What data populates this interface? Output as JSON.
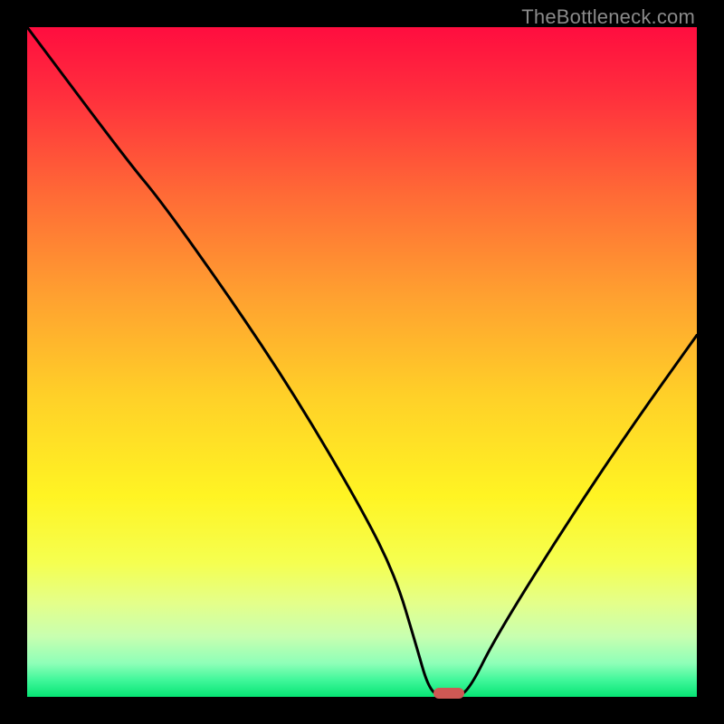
{
  "watermark": "TheBottleneck.com",
  "marker": {
    "x_pct": 63,
    "y_pct": 99.4
  },
  "chart_data": {
    "type": "line",
    "title": "",
    "xlabel": "",
    "ylabel": "",
    "xlim": [
      0,
      100
    ],
    "ylim": [
      0,
      100
    ],
    "grid": false,
    "legend": false,
    "annotations": [],
    "series": [
      {
        "name": "bottleneck-curve",
        "x": [
          0,
          15,
          20,
          30,
          40,
          50,
          55,
          58,
          60,
          62,
          64,
          66,
          70,
          80,
          90,
          100
        ],
        "values": [
          100,
          80,
          74,
          60,
          45,
          28,
          18,
          8,
          1,
          0,
          0,
          1,
          9,
          25,
          40,
          54
        ]
      }
    ],
    "background_gradient_stops": [
      {
        "offset": 0.0,
        "color": "#ff0d3f"
      },
      {
        "offset": 0.1,
        "color": "#ff2e3d"
      },
      {
        "offset": 0.25,
        "color": "#ff6a36"
      },
      {
        "offset": 0.4,
        "color": "#ffa030"
      },
      {
        "offset": 0.55,
        "color": "#ffd028"
      },
      {
        "offset": 0.7,
        "color": "#fff423"
      },
      {
        "offset": 0.8,
        "color": "#f5ff50"
      },
      {
        "offset": 0.86,
        "color": "#e4ff8a"
      },
      {
        "offset": 0.91,
        "color": "#c8ffb0"
      },
      {
        "offset": 0.95,
        "color": "#8effb8"
      },
      {
        "offset": 0.975,
        "color": "#40f79a"
      },
      {
        "offset": 1.0,
        "color": "#06e474"
      }
    ]
  }
}
